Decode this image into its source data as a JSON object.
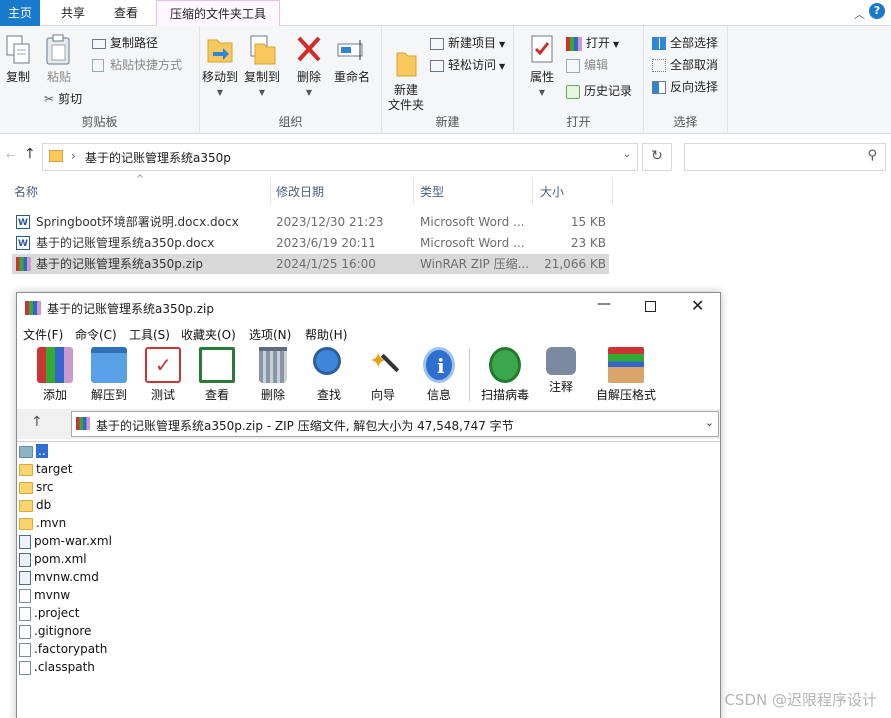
{
  "explorer": {
    "tabs": [
      {
        "label": "主页"
      },
      {
        "label": "共享"
      },
      {
        "label": "查看"
      },
      {
        "label": "压缩的文件夹工具"
      }
    ],
    "ribbon": {
      "clipboard": {
        "label": "剪贴板",
        "copy": "复制",
        "paste": "粘贴",
        "copy_path": "复制路径",
        "paste_shortcut": "粘贴快捷方式",
        "cut": "剪切"
      },
      "organize": {
        "label": "组织",
        "move_to": "移动到",
        "copy_to": "复制到",
        "delete": "删除",
        "rename": "重命名"
      },
      "new": {
        "label": "新建",
        "new_folder": "新建\n文件夹",
        "new_item": "新建项目",
        "easy_access": "轻松访问"
      },
      "open": {
        "label": "打开",
        "properties": "属性",
        "open": "打开",
        "edit": "编辑",
        "history": "历史记录"
      },
      "select": {
        "label": "选择",
        "select_all": "全部选择",
        "select_none": "全部取消",
        "invert": "反向选择"
      }
    },
    "address": {
      "path": "基于的记账管理系统a350p"
    },
    "columns": {
      "name": "名称",
      "date": "修改日期",
      "type": "类型",
      "size": "大小"
    },
    "files": [
      {
        "name": "Springboot环境部署说明.docx.docx",
        "date": "2023/12/30 21:23",
        "type": "Microsoft Word ...",
        "size": "15 KB",
        "icon": "word-icon"
      },
      {
        "name": "基于的记账管理系统a350p.docx",
        "date": "2023/6/19 20:11",
        "type": "Microsoft Word ...",
        "size": "23 KB",
        "icon": "word-icon"
      },
      {
        "name": "基于的记账管理系统a350p.zip",
        "date": "2024/1/25 16:00",
        "type": "WinRAR ZIP 压缩...",
        "size": "21,066 KB",
        "icon": "winrar-icon"
      }
    ]
  },
  "winrar": {
    "title": "基于的记账管理系统a350p.zip",
    "menu": [
      "文件(F)",
      "命令(C)",
      "工具(S)",
      "收藏夹(O)",
      "选项(N)",
      "帮助(H)"
    ],
    "toolbar": [
      "添加",
      "解压到",
      "测试",
      "查看",
      "删除",
      "查找",
      "向导",
      "信息",
      "扫描病毒",
      "注释",
      "自解压格式"
    ],
    "path": "基于的记账管理系统a350p.zip - ZIP 压缩文件, 解包大小为 47,548,747 字节",
    "items": [
      {
        "name": "..",
        "kind": "up"
      },
      {
        "name": "target",
        "kind": "folder"
      },
      {
        "name": "src",
        "kind": "folder"
      },
      {
        "name": "db",
        "kind": "folder"
      },
      {
        "name": ".mvn",
        "kind": "folder"
      },
      {
        "name": "pom-war.xml",
        "kind": "xml"
      },
      {
        "name": "pom.xml",
        "kind": "xml"
      },
      {
        "name": "mvnw.cmd",
        "kind": "cmd"
      },
      {
        "name": "mvnw",
        "kind": "file"
      },
      {
        "name": ".project",
        "kind": "file"
      },
      {
        "name": ".gitignore",
        "kind": "file"
      },
      {
        "name": ".factorypath",
        "kind": "file"
      },
      {
        "name": ".classpath",
        "kind": "file"
      }
    ]
  },
  "watermark": "CSDN @迟限程序设计"
}
